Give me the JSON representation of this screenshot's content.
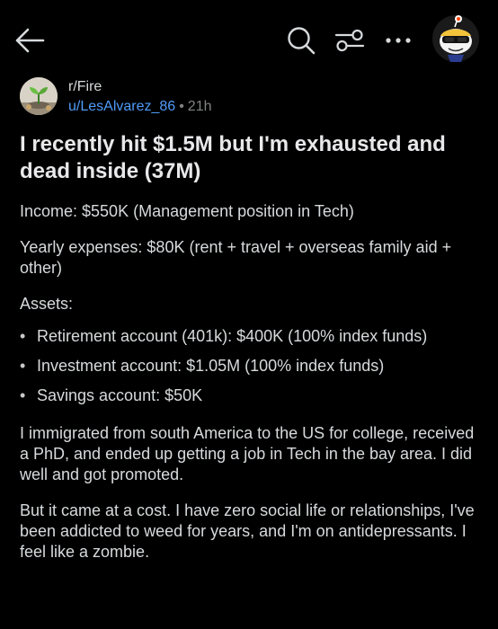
{
  "topbar": {
    "back_icon": "arrow-left-icon",
    "search_icon": "search-icon",
    "filter_icon": "filter-sliders-icon",
    "more_icon": "more-horizontal-icon",
    "avatar_icon": "snoo-avatar-icon"
  },
  "post": {
    "subreddit": "r/Fire",
    "author": "u/LesAlvarez_86",
    "separator": "•",
    "age": "21h",
    "title": "I recently hit $1.5M but I'm exhausted and dead inside (37M)",
    "income": "Income: $550K (Management position in Tech)",
    "expenses": "Yearly expenses: $80K (rent + travel + overseas family aid + other)",
    "assets_heading": "Assets:",
    "assets": [
      "Retirement account (401k): $400K (100% index funds)",
      "Investment account: $1.05M (100% index funds)",
      "Savings account: $50K"
    ],
    "paragraph_1": "I immigrated from south America to the US for college, received a PhD, and ended up getting a job in Tech in the bay area. I did well and got promoted.",
    "paragraph_2": "But it came at a cost. I have zero social life or relationships, I've been addicted to weed for years, and I'm on antidepressants. I feel like a zombie."
  },
  "colors": {
    "background": "#000000",
    "text": "#d7dadc",
    "author_link": "#4f9cf9",
    "muted": "#818384"
  }
}
